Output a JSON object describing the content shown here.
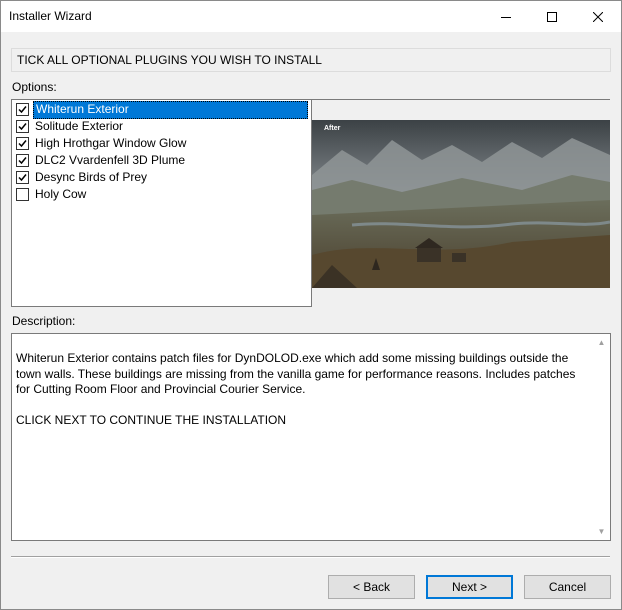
{
  "window": {
    "title": "Installer Wizard",
    "controls": {
      "minimize": "minimize-icon",
      "maximize": "maximize-icon",
      "close": "close-icon"
    }
  },
  "header": {
    "text": "TICK ALL OPTIONAL PLUGINS YOU WISH TO INSTALL"
  },
  "options": {
    "label": "Options:",
    "items": [
      {
        "label": "Whiterun Exterior",
        "checked": true,
        "selected": true
      },
      {
        "label": "Solitude Exterior",
        "checked": true,
        "selected": false
      },
      {
        "label": "High Hrothgar Window Glow",
        "checked": true,
        "selected": false
      },
      {
        "label": "DLC2 Vvardenfell 3D Plume",
        "checked": true,
        "selected": false
      },
      {
        "label": "Desync Birds of Prey",
        "checked": true,
        "selected": false
      },
      {
        "label": "Holy Cow",
        "checked": false,
        "selected": false
      }
    ]
  },
  "preview": {
    "caption": "After"
  },
  "description": {
    "label": "Description:",
    "body": "Whiterun Exterior contains patch files for DynDOLOD.exe which add some missing buildings outside the town walls. These buildings are missing from the vanilla game for performance reasons. Includes patches for Cutting Room Floor and Provincial Courier Service.",
    "footer": "CLICK NEXT TO CONTINUE THE INSTALLATION"
  },
  "buttons": {
    "back": "< Back",
    "next": "Next >",
    "cancel": "Cancel"
  },
  "colors": {
    "selection": "#0078d7",
    "window_bg": "#f0f0f0"
  }
}
